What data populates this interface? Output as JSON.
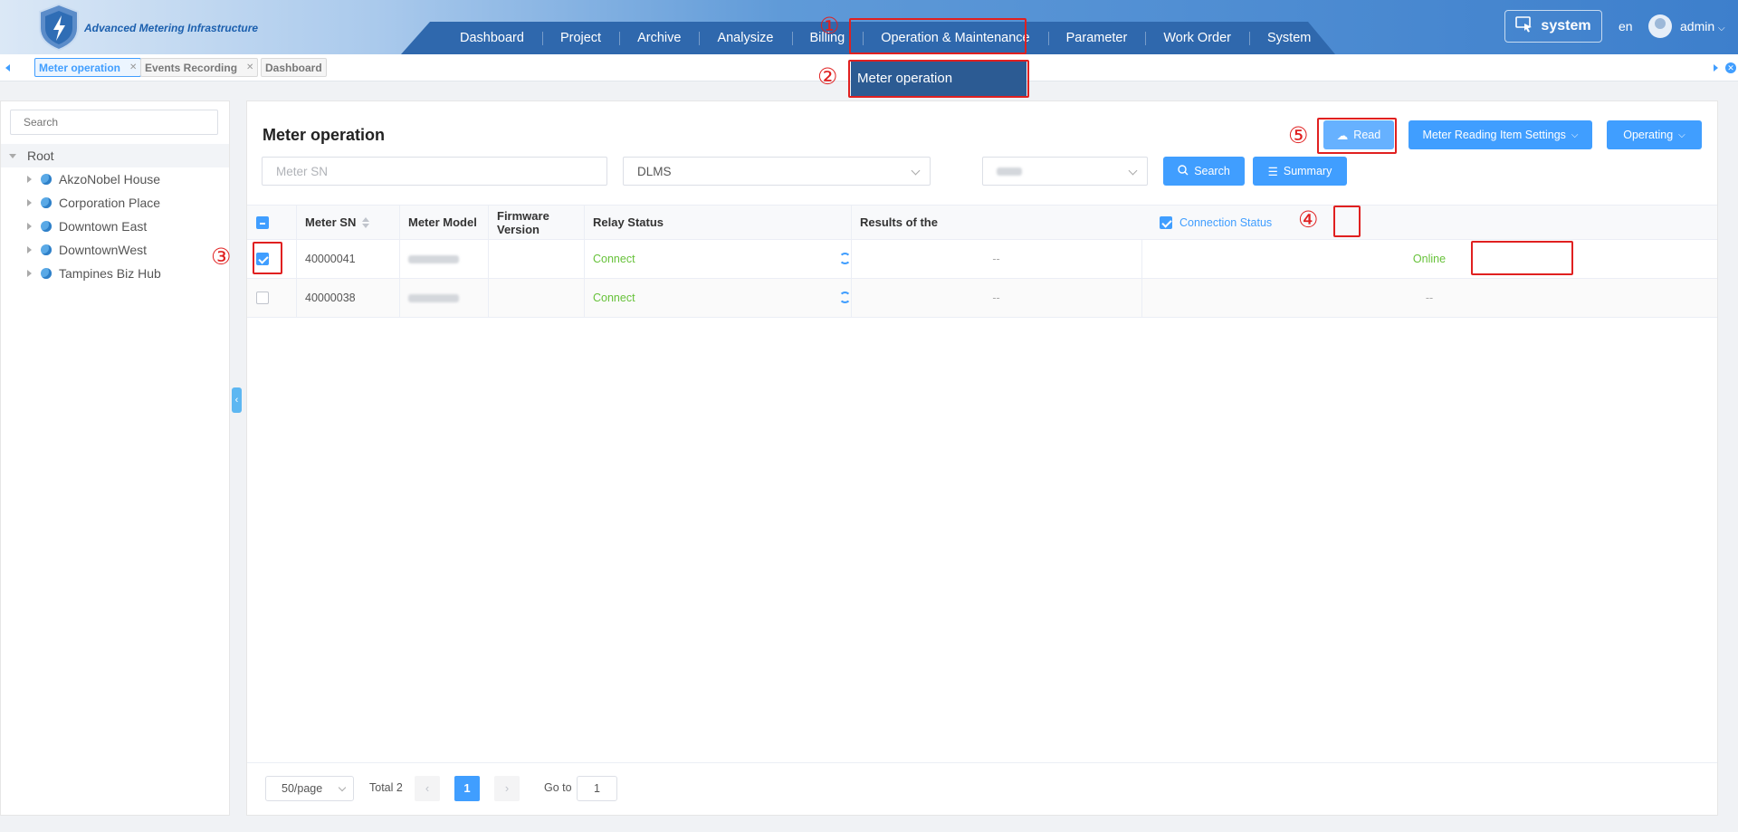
{
  "header": {
    "brand": "Advanced Metering Infrastructure",
    "system_label": "system",
    "language": "en",
    "user": "admin"
  },
  "nav": [
    "Dashboard",
    "Project",
    "Archive",
    "Analysize",
    "Billing",
    "Operation & Maintenance",
    "Parameter",
    "Work Order",
    "System"
  ],
  "dropdown": {
    "item": "Meter operation"
  },
  "tabs": [
    {
      "label": "Meter operation",
      "closable": true,
      "active": true
    },
    {
      "label": "Events Recording",
      "closable": true,
      "active": false
    },
    {
      "label": "Dashboard",
      "closable": false,
      "active": false
    }
  ],
  "sidebar": {
    "search_placeholder": "Search",
    "root": "Root",
    "items": [
      "AkzoNobel House",
      "Corporation Place",
      "Downtown East",
      "DowntownWest",
      "Tampines Biz Hub"
    ]
  },
  "panel": {
    "title": "Meter operation",
    "filters": {
      "meter_sn_placeholder": "Meter SN",
      "protocol": "DLMS"
    },
    "buttons": {
      "search": "Search",
      "summary": "Summary",
      "read": "Read",
      "reading_settings": "Meter Reading Item Settings",
      "operating": "Operating"
    },
    "columns": {
      "meter_sn": "Meter SN",
      "meter_model": "Meter Model",
      "firmware": "Firmware Version",
      "relay": "Relay Status",
      "results": "Results of the",
      "connection": "Connection Status"
    },
    "rows": [
      {
        "sn": "40000041",
        "relay": "Connect",
        "result": "--",
        "connection": "Online",
        "checked": true
      },
      {
        "sn": "40000038",
        "relay": "Connect",
        "result": "--",
        "connection": "--",
        "checked": false
      }
    ],
    "pagination": {
      "page_size": "50/page",
      "total": "Total 2",
      "current": "1",
      "goto_label": "Go to",
      "goto_value": "1"
    }
  },
  "annotations": [
    "1",
    "2",
    "3",
    "4",
    "5"
  ]
}
